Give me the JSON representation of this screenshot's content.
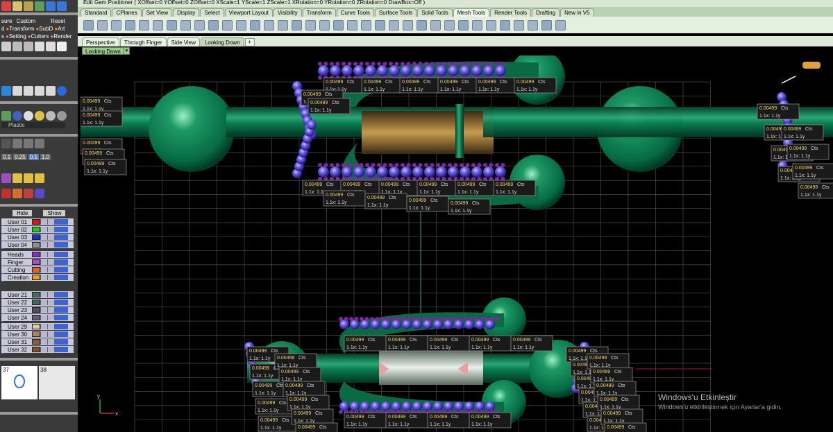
{
  "titlebar": {
    "text": "Edit Gem Positioner ( XOffset=0  YOffset=0  ZOffset=0  XScale=1  YScale=1  ZScale=1  XRotation=0  YRotation=0  ZRotation=0  DrawBox=Off )"
  },
  "toolbar_tabs": [
    "Standard",
    "CPlanes",
    "Set View",
    "Display",
    "Select",
    "Viewport Layout",
    "Visibility",
    "Transform",
    "Curve Tools",
    "Surface Tools",
    "Solid Tools",
    "Mesh Tools",
    "Render Tools",
    "Drafting",
    "New in V5"
  ],
  "active_toolbar_tab": "Mesh Tools",
  "viewport_tabs": [
    "Perspective",
    "Through Finger",
    "Side View",
    "Looking Down"
  ],
  "active_viewport_tab": "Looking Down",
  "viewport_title": "Looking Down",
  "left_panel": {
    "menu_row1": {
      "a": "sure",
      "b": "Custom",
      "c": "Reset"
    },
    "menu_row2": {
      "a": "d",
      "b": "Transform",
      "c": "SubD",
      "d": "Art"
    },
    "menu_row3": {
      "a": "s",
      "b": "Setting",
      "c": "Cutters",
      "d": "Render"
    },
    "material": "Plastic",
    "values": [
      "0.1",
      "0.25",
      "0.5",
      "1.0"
    ],
    "hide_label": "Hide",
    "show_label": "Show",
    "layers_a": [
      {
        "name": "User 01",
        "color": "#e01010"
      },
      {
        "name": "User 02",
        "color": "#10d010"
      },
      {
        "name": "User 03",
        "color": "#1030e0"
      },
      {
        "name": "User 04",
        "color": "#909090"
      }
    ],
    "layers_b": [
      {
        "name": "Heads",
        "color": "#8a2ad0"
      },
      {
        "name": "Finger",
        "color": "#a050d0"
      },
      {
        "name": "Cutting",
        "color": "#e06020"
      },
      {
        "name": "Creation",
        "color": "#f0a000"
      }
    ],
    "layers_c": [
      {
        "name": "User 21",
        "color": "#3f7060"
      },
      {
        "name": "User 22",
        "color": "#3a6a5a"
      },
      {
        "name": "User 23",
        "color": "#5a4a6a"
      },
      {
        "name": "User 24",
        "color": "#6a5a7a"
      }
    ],
    "layers_d": [
      {
        "name": "User 29",
        "color": "#e0c8a0"
      },
      {
        "name": "User 30",
        "color": "#b08060"
      },
      {
        "name": "User 31",
        "color": "#8a6040"
      },
      {
        "name": "User 32",
        "color": "#7a5030"
      }
    ],
    "thumb_num_a": "37",
    "thumb_num_b": "38"
  },
  "gem_labels": {
    "size": "0.00499",
    "unit": "Cts",
    "scale": "1.1x: 1.1y",
    "short": "s"
  },
  "axes": {
    "x": "x",
    "y": "y"
  },
  "watermark": {
    "title": "Windows'u Etkinleştir",
    "subtitle": "Windows'u etkinleştirmek için Ayarlar'a gidin."
  },
  "colors": {
    "model": "#0a7a4e",
    "gems": "#6b5ce8",
    "prongs": "#7a2a9a",
    "grid": "#4a4a4a",
    "label_bg": "#1a1a1a",
    "label_text": "#f2d46a"
  }
}
